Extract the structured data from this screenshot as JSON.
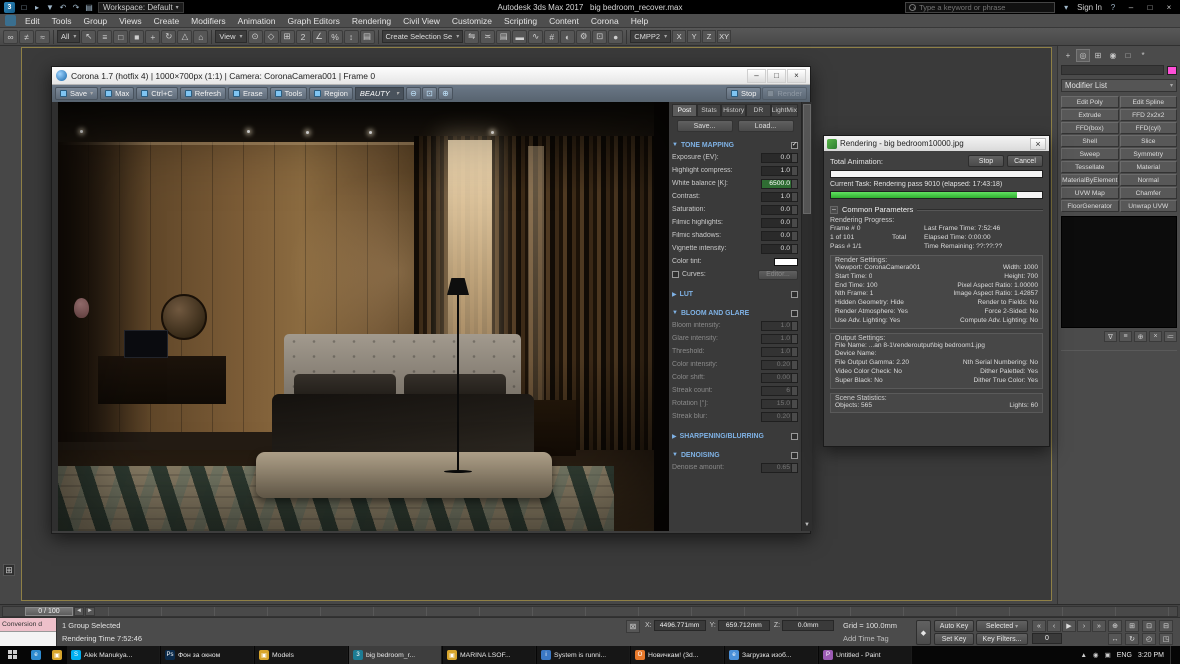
{
  "colors": {
    "progress_green": "#34c934",
    "section_header_blue": "#7fb2e5",
    "object_color_swatch": "#ff4fd8",
    "viewport_border": "#8f8046"
  },
  "titlebar": {
    "app_title": "Autodesk 3ds Max 2017",
    "file_name": "big bedroom_recover.max",
    "workspace_label": "Workspace: Default",
    "search_placeholder": "Type a keyword or phrase",
    "sign_in_label": "Sign In",
    "help_label": "?",
    "qat": [
      {
        "name": "new-scene-icon",
        "glyph": "□"
      },
      {
        "name": "open-file-icon",
        "glyph": "▸"
      },
      {
        "name": "save-file-icon",
        "glyph": "▼"
      },
      {
        "name": "undo-icon",
        "glyph": "↶"
      },
      {
        "name": "redo-icon",
        "glyph": "↷"
      },
      {
        "name": "project-folder-icon",
        "glyph": "▤"
      }
    ]
  },
  "menubar": {
    "items": [
      "Edit",
      "Tools",
      "Group",
      "Views",
      "Create",
      "Modifiers",
      "Animation",
      "Graph Editors",
      "Rendering",
      "Civil View",
      "Customize",
      "Scripting",
      "Content",
      "Corona",
      "Help"
    ]
  },
  "toolbar": {
    "filter_label": "All",
    "ref_coord_label": "View",
    "selection_set_label": "Create Selection Se",
    "named_set_value": "CMPP2",
    "axis_buttons": [
      "X",
      "Y",
      "Z",
      "XY"
    ],
    "group_link": [
      {
        "name": "select-and-link-icon",
        "glyph": "∞"
      },
      {
        "name": "unlink-selection-icon",
        "glyph": "≠"
      },
      {
        "name": "bind-to-space-warp-icon",
        "glyph": "≈"
      }
    ],
    "group_select": [
      {
        "name": "select-object-icon",
        "glyph": "↖"
      },
      {
        "name": "select-by-name-icon",
        "glyph": "≡"
      },
      {
        "name": "rectangular-selection-region-icon",
        "glyph": "□"
      },
      {
        "name": "window-crossing-icon",
        "glyph": "■"
      },
      {
        "name": "select-and-move-icon",
        "glyph": "+"
      },
      {
        "name": "select-and-rotate-icon",
        "glyph": "↻"
      },
      {
        "name": "select-and-scale-icon",
        "glyph": "△"
      },
      {
        "name": "select-and-place-icon",
        "glyph": "⌂"
      }
    ],
    "group_center": [
      {
        "name": "use-center-icon",
        "glyph": "⊙"
      },
      {
        "name": "select-and-manipulate-icon",
        "glyph": "◇"
      },
      {
        "name": "keyboard-override-icon",
        "glyph": "⊞"
      },
      {
        "name": "snap-toggle-icon",
        "glyph": "2"
      },
      {
        "name": "angle-snap-icon",
        "glyph": "∠"
      },
      {
        "name": "percent-snap-icon",
        "glyph": "%"
      },
      {
        "name": "spinner-snap-icon",
        "glyph": "↕"
      },
      {
        "name": "edit-named-selection-sets-icon",
        "glyph": "▤"
      }
    ],
    "group_tools": [
      {
        "name": "mirror-icon",
        "glyph": "⇋"
      },
      {
        "name": "align-icon",
        "glyph": "≍"
      },
      {
        "name": "layer-explorer-icon",
        "glyph": "▤"
      },
      {
        "name": "ribbon-toggle-icon",
        "glyph": "▬"
      },
      {
        "name": "curve-editor-icon",
        "glyph": "∿"
      },
      {
        "name": "schematic-view-icon",
        "glyph": "#"
      },
      {
        "name": "material-editor-icon",
        "glyph": "◐"
      },
      {
        "name": "render-setup-icon",
        "glyph": "⚙"
      },
      {
        "name": "rendered-frame-window-icon",
        "glyph": "⊡"
      },
      {
        "name": "render-production-icon",
        "glyph": "●"
      }
    ]
  },
  "corona": {
    "title": "Corona 1.7 (hotfix 4) | 1000×700px (1:1) | Camera: CoronaCamera001 | Frame 0",
    "toolbar": {
      "save": "Save",
      "max": "Max",
      "copy": "Ctrl+C",
      "refresh": "Refresh",
      "erase": "Erase",
      "tools": "Tools",
      "region": "Region",
      "channel": "BEAUTY",
      "stop": "Stop",
      "render": "Render"
    },
    "zoom_icons": [
      {
        "name": "vfb-zoom-out-icon",
        "glyph": "⊖"
      },
      {
        "name": "vfb-zoom-reset-icon",
        "glyph": "⊡"
      },
      {
        "name": "vfb-zoom-in-icon",
        "glyph": "⊕"
      }
    ],
    "tabs": [
      {
        "label": "Post",
        "active": true
      },
      {
        "label": "Stats"
      },
      {
        "label": "History"
      },
      {
        "label": "DR"
      },
      {
        "label": "LightMix"
      }
    ],
    "save_button": "Save...",
    "load_button": "Load...",
    "sections": {
      "tone_mapping": {
        "title": "TONE MAPPING",
        "tri": "▼",
        "check": "✓",
        "rows": [
          {
            "label": "Exposure (EV):",
            "value": "0.0"
          },
          {
            "label": "Highlight compress:",
            "value": "1.0"
          },
          {
            "label": "White balance [K]:",
            "value": "6500.0",
            "selected": true
          },
          {
            "label": "Contrast:",
            "value": "1.0"
          },
          {
            "label": "Saturation:",
            "value": "0.0"
          },
          {
            "label": "Filmic highlights:",
            "value": "0.0"
          },
          {
            "label": "Filmic shadows:",
            "value": "0.0"
          },
          {
            "label": "Vignette intensity:",
            "value": "0.0"
          }
        ],
        "color_tint_label": "Color tint:",
        "curves_label": "Curves:",
        "curves_button": "Editor..."
      },
      "lut": {
        "title": "LUT",
        "tri": "▶",
        "check": ""
      },
      "bloom_glare": {
        "title": "BLOOM AND GLARE",
        "tri": "▼",
        "check": "",
        "rows": [
          {
            "label": "Bloom intensity:",
            "value": "1.0",
            "disabled": true
          },
          {
            "label": "Glare intensity:",
            "value": "1.0",
            "disabled": true
          },
          {
            "label": "Threshold:",
            "value": "1.0",
            "disabled": true
          },
          {
            "label": "Color intensity:",
            "value": "0.20",
            "disabled": true
          },
          {
            "label": "Color shift:",
            "value": "0.00",
            "disabled": true
          },
          {
            "label": "Streak count:",
            "value": "6",
            "disabled": true
          },
          {
            "label": "Rotation [°]:",
            "value": "15.0",
            "disabled": true
          },
          {
            "label": "Streak blur:",
            "value": "0.20",
            "disabled": true
          }
        ]
      },
      "sharpening": {
        "title": "SHARPENING/BLURRING",
        "tri": "▶",
        "check": ""
      },
      "denoising": {
        "title": "DENOISING",
        "tri": "▼",
        "check": "",
        "rows": [
          {
            "label": "Denoise amount:",
            "value": "0.65",
            "disabled": true
          }
        ]
      }
    }
  },
  "render_dialog": {
    "title": "Rendering - big bedroom10000.jpg",
    "total_animation_label": "Total Animation:",
    "stop_button": "Stop",
    "cancel_button": "Cancel",
    "current_task": "Current Task:  Rendering pass 9010 (elapsed: 17:43:18)",
    "pass_progress_percent": 88,
    "common_parameters_title": "Common Parameters",
    "rendering_progress_label": "Rendering Progress:",
    "progress_rows": [
      {
        "left": "Frame # 0",
        "mid": "",
        "right": "Last Frame Time: 7:52:46"
      },
      {
        "left": "1 of 101",
        "mid": "Total",
        "right": "Elapsed Time: 0:00:00"
      },
      {
        "left": "Pass # 1/1",
        "mid": "",
        "right": "Time Remaining: ??:??:??"
      }
    ],
    "render_settings_label": "Render Settings:",
    "render_settings_rows": [
      {
        "left": "Viewport: CoronaCamera001",
        "right": "Width: 1000"
      },
      {
        "left": "Start Time: 0",
        "right": "Height: 700"
      },
      {
        "left": "End Time: 100",
        "right": "Pixel Aspect Ratio: 1.00000"
      },
      {
        "left": "Nth Frame: 1",
        "right": "Image Aspect Ratio: 1.42857"
      },
      {
        "left": "Hidden Geometry: Hide",
        "right": "Render to Fields: No"
      },
      {
        "left": "Render Atmosphere: Yes",
        "right": "Force 2-Sided: No"
      },
      {
        "left": "Use Adv. Lighting: Yes",
        "right": "Compute Adv. Lighting: No"
      }
    ],
    "output_settings_label": "Output Settings:",
    "output_rows": [
      {
        "left": "File Name: ...an 8-1\\renderoutput\\big bedroom1.jpg",
        "right": ""
      },
      {
        "left": "Device Name:",
        "right": ""
      },
      {
        "left": "File Output Gamma: 2.20",
        "right": "Nth Serial Numbering: No"
      },
      {
        "left": "Video Color Check: No",
        "right": "Dither Paletted: Yes"
      },
      {
        "left": "Super Black: No",
        "right": "Dither True Color: Yes"
      }
    ],
    "scene_statistics_label": "Scene Statistics:",
    "scene_rows": [
      {
        "left": "Objects: 565",
        "right": "Lights: 60"
      }
    ]
  },
  "command_panel": {
    "tabs": [
      {
        "name": "create-tab-icon",
        "glyph": "+"
      },
      {
        "name": "modify-tab-icon",
        "glyph": "◎",
        "active": true
      },
      {
        "name": "hierarchy-tab-icon",
        "glyph": "⊞"
      },
      {
        "name": "motion-tab-icon",
        "glyph": "◉"
      },
      {
        "name": "display-tab-icon",
        "glyph": "□"
      },
      {
        "name": "utilities-tab-icon",
        "glyph": "*"
      }
    ],
    "modifier_list_label": "Modifier List",
    "modifier_buttons": [
      "Edit Poly",
      "Edit Spline",
      "Extrude",
      "FFD 2x2x2",
      "FFD(box)",
      "FFD(cyl)",
      "Shell",
      "Slice",
      "Sweep",
      "Symmetry",
      "Tessellate",
      "Material",
      "MaterialByElement",
      "Normal",
      "UVW Map",
      "Chamfer",
      "FloorGenerator",
      "Unwrap UVW"
    ],
    "stack_icons": [
      {
        "name": "pin-stack-icon",
        "glyph": "∇"
      },
      {
        "name": "show-end-result-icon",
        "glyph": "≡"
      },
      {
        "name": "make-unique-icon",
        "glyph": "⊕"
      },
      {
        "name": "remove-modifier-icon",
        "glyph": "×"
      },
      {
        "name": "configure-modifier-sets-icon",
        "glyph": "≔"
      }
    ]
  },
  "timeline": {
    "slider_label": "0 / 100"
  },
  "statusbar": {
    "maxscript_line": "Conversion d",
    "prompt_line": "1 Group Selected",
    "render_time_line": "Rendering Time 7:52:46",
    "coord_x_label": "X:",
    "coord_x": "4496.771mm",
    "coord_y_label": "Y:",
    "coord_y": "659.712mm",
    "coord_z_label": "Z:",
    "coord_z": "0.0mm",
    "grid_label": "Grid = 100.0mm",
    "time_tag_label": "Add Time Tag",
    "auto_key": "Auto Key",
    "selected": "Selected",
    "set_key": "Set Key",
    "key_filters": "Key Filters...",
    "frame_field": "0",
    "playback_icons": [
      {
        "name": "go-to-start-icon",
        "glyph": "«"
      },
      {
        "name": "previous-frame-icon",
        "glyph": "‹"
      },
      {
        "name": "play-icon",
        "glyph": "▶"
      },
      {
        "name": "next-frame-icon",
        "glyph": "›"
      },
      {
        "name": "go-to-end-icon",
        "glyph": "»"
      }
    ],
    "nav_icons": [
      {
        "name": "zoom-icon",
        "glyph": "⊕"
      },
      {
        "name": "zoom-all-icon",
        "glyph": "⊞"
      },
      {
        "name": "zoom-extents-icon",
        "glyph": "⊡"
      },
      {
        "name": "zoom-region-icon",
        "glyph": "⊟"
      },
      {
        "name": "pan-icon",
        "glyph": "↔"
      },
      {
        "name": "orbit-icon",
        "glyph": "↻"
      },
      {
        "name": "time-config-icon",
        "glyph": "◴"
      },
      {
        "name": "maximize-viewport-icon",
        "glyph": "◳"
      }
    ]
  },
  "taskbar": {
    "tray_lang": "ENG",
    "tray_time": "3:20 PM",
    "pinned": [
      {
        "name": "browser-pinned-icon",
        "glyph": "e",
        "color": "#2e8bd0"
      },
      {
        "name": "explorer-pinned-icon",
        "glyph": "▣",
        "color": "#d8a52c"
      }
    ],
    "items": [
      {
        "label": "Alek Manukya...",
        "glyph": "S",
        "color": "#00aff0"
      },
      {
        "label": "Фон за окном",
        "glyph": "Ps",
        "color": "#0a2a4a"
      },
      {
        "label": "Models",
        "glyph": "▣",
        "color": "#d8a52c"
      },
      {
        "label": "big bedroom_r...",
        "glyph": "3",
        "color": "#1c7c94",
        "active": true
      },
      {
        "label": "MARINA LSOF...",
        "glyph": "▣",
        "color": "#d8a52c"
      },
      {
        "label": "System is runni...",
        "glyph": "i",
        "color": "#3b78c4"
      },
      {
        "label": "Новичкам! (3d...",
        "glyph": "O",
        "color": "#e8792b"
      },
      {
        "label": "Загрузка изоб...",
        "glyph": "e",
        "color": "#4a90d9"
      },
      {
        "label": "Untitled - Paint",
        "glyph": "P",
        "color": "#9c5bb5"
      }
    ]
  }
}
